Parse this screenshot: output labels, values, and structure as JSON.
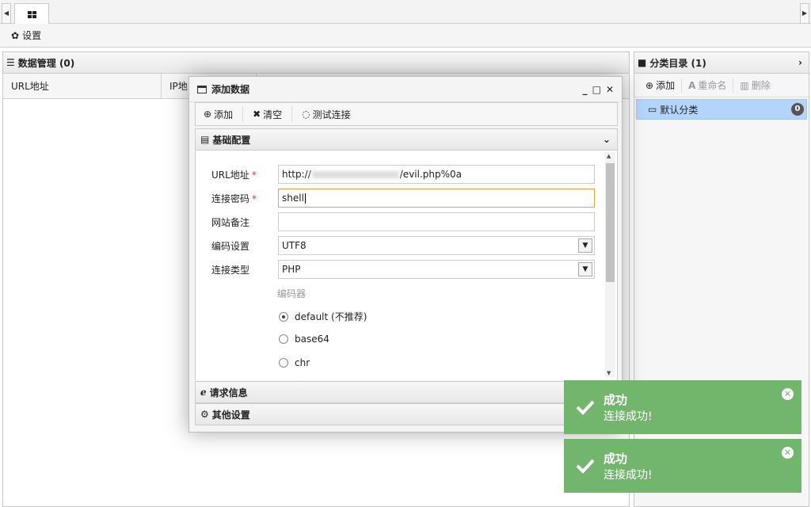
{
  "toolbar": {
    "settings_label": "设置"
  },
  "data_panel": {
    "title": "数据管理 (0)",
    "columns": [
      "URL地址",
      "IP地"
    ]
  },
  "category_panel": {
    "title": "分类目录 (1)",
    "add_label": "添加",
    "rename_label": "重命名",
    "delete_label": "删除",
    "items": [
      {
        "label": "默认分类",
        "count": "0"
      }
    ]
  },
  "dialog": {
    "title": "添加数据",
    "toolbar": {
      "add_label": "添加",
      "clear_label": "清空",
      "test_label": "测试连接"
    },
    "section_basic": "基础配置",
    "section_request": "请求信息",
    "section_other": "其他设置",
    "fields": {
      "url": {
        "label": "URL地址",
        "value_prefix": "http://",
        "value_suffix": "/evil.php%0a"
      },
      "password": {
        "label": "连接密码",
        "value": "shell"
      },
      "note": {
        "label": "网站备注",
        "value": ""
      },
      "encoding": {
        "label": "编码设置",
        "value": "UTF8"
      },
      "type": {
        "label": "连接类型",
        "value": "PHP"
      }
    },
    "encoder": {
      "label": "编码器",
      "options": [
        {
          "label": "default (不推荐)",
          "checked": true
        },
        {
          "label": "base64",
          "checked": false
        },
        {
          "label": "chr",
          "checked": false
        }
      ]
    }
  },
  "toasts": [
    {
      "title": "成功",
      "message": "连接成功!"
    },
    {
      "title": "成功",
      "message": "连接成功!"
    }
  ],
  "colors": {
    "toast_bg": "#72b66e",
    "selected_item": "#b3d4fb",
    "focus_border": "#e0a940"
  }
}
